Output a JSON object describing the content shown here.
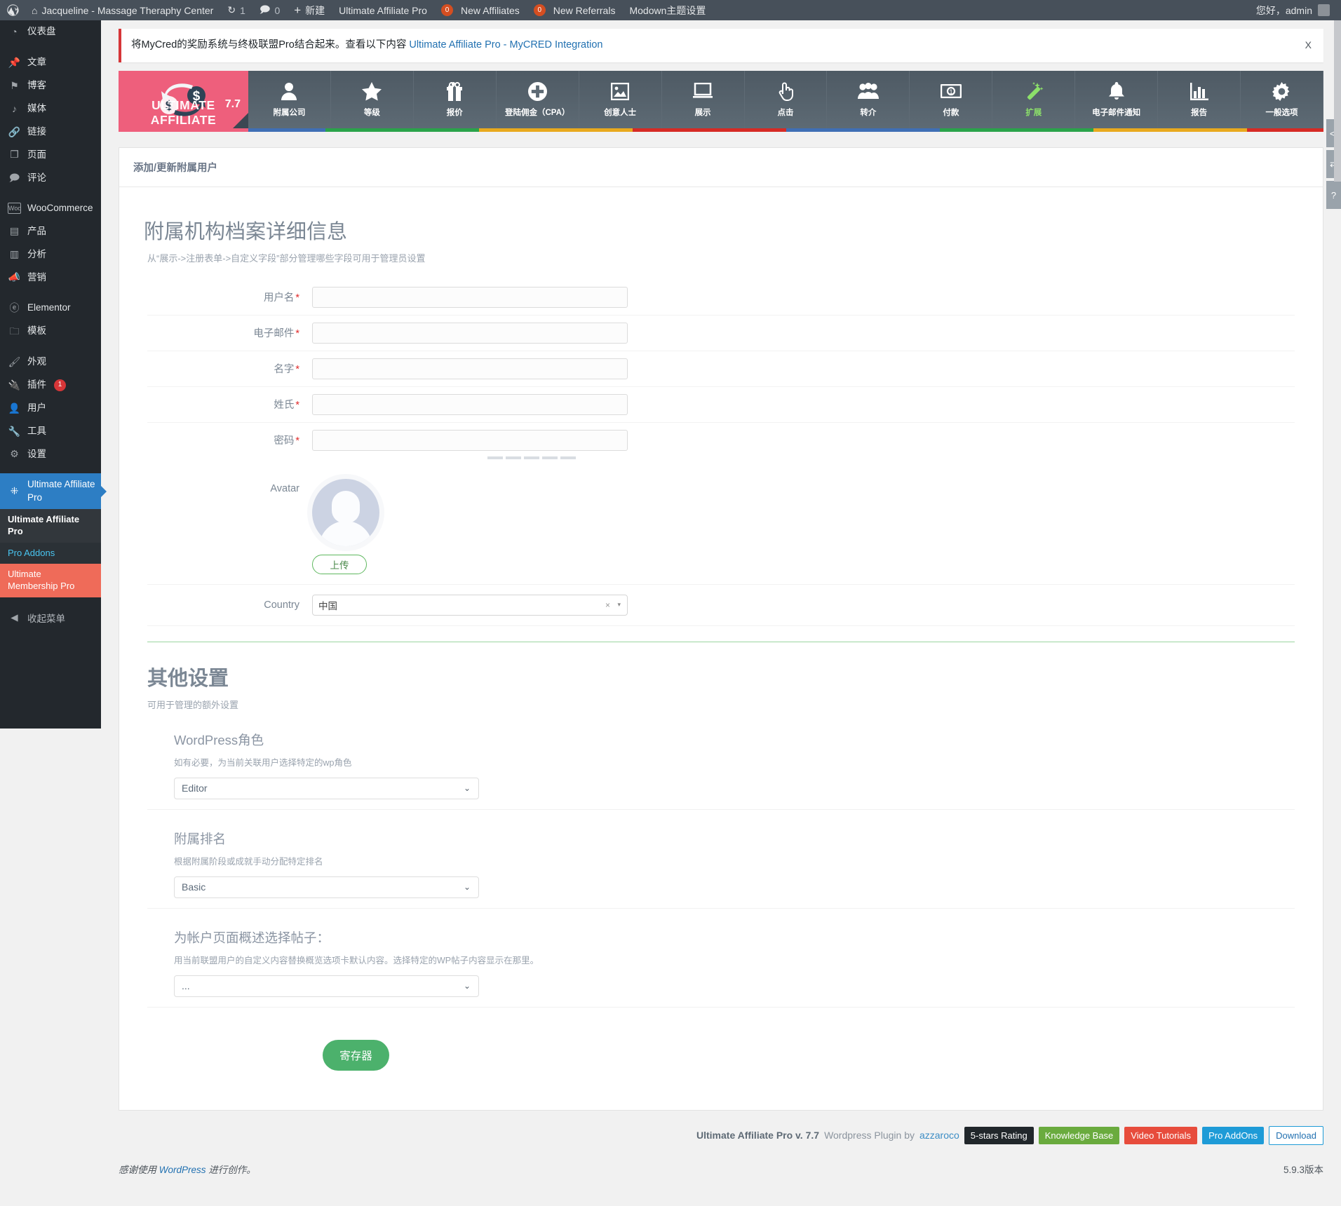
{
  "adminbar": {
    "logo_icon": "wordpress-icon",
    "home_icon": "home-icon",
    "site_name": "Jacqueline - Massage Theraphy Center",
    "updates_icon": "updates-icon",
    "updates_count": "1",
    "comments_icon": "comment-icon",
    "comments_count": "0",
    "new_icon": "plus-icon",
    "new_label": "新建",
    "uap_label": "Ultimate Affiliate Pro",
    "new_affiliates_badge": "0",
    "new_affiliates_label": "New Affiliates",
    "new_referrals_badge": "0",
    "new_referrals_label": "New Referrals",
    "modown_label": "Modown主题设置",
    "howdy": "您好，admin"
  },
  "sidebar": {
    "items": [
      {
        "icon": "dashboard-icon",
        "label": "仪表盘",
        "glyph": "◷"
      },
      {
        "icon": "pin-icon",
        "label": "文章",
        "glyph": "✎"
      },
      {
        "icon": "flag-icon",
        "label": "博客",
        "glyph": "⚑"
      },
      {
        "icon": "media-icon",
        "label": "媒体",
        "glyph": "♬"
      },
      {
        "icon": "link-icon",
        "label": "链接",
        "glyph": "🔗"
      },
      {
        "icon": "page-icon",
        "label": "页面",
        "glyph": "❐"
      },
      {
        "icon": "comment-icon",
        "label": "评论",
        "glyph": "💬"
      },
      {
        "icon": "woocommerce-icon",
        "label": "WooCommerce",
        "glyph": "W"
      },
      {
        "icon": "product-icon",
        "label": "产品",
        "glyph": "▤"
      },
      {
        "icon": "analytics-icon",
        "label": "分析",
        "glyph": "▥"
      },
      {
        "icon": "marketing-icon",
        "label": "营销",
        "glyph": "📢"
      },
      {
        "icon": "elementor-icon",
        "label": "Elementor",
        "glyph": "Ⓔ"
      },
      {
        "icon": "template-icon",
        "label": "模板",
        "glyph": "🗀"
      },
      {
        "icon": "appearance-icon",
        "label": "外观",
        "glyph": "🖌"
      },
      {
        "icon": "plugins-icon",
        "label": "插件",
        "glyph": "🔌",
        "badge": "1"
      },
      {
        "icon": "users-icon",
        "label": "用户",
        "glyph": "👤"
      },
      {
        "icon": "tools-icon",
        "label": "工具",
        "glyph": "🔧"
      },
      {
        "icon": "settings-icon",
        "label": "设置",
        "glyph": "⚙"
      }
    ],
    "current": {
      "icon": "sitemap-icon",
      "label": "Ultimate Affiliate Pro",
      "glyph": "⛓"
    },
    "submenu": [
      {
        "label": "Ultimate Affiliate Pro",
        "state": "head"
      },
      {
        "label": "Pro Addons",
        "state": "active"
      },
      {
        "label": "Ultimate Membership Pro",
        "state": "ump"
      }
    ],
    "collapse": {
      "icon": "collapse-icon",
      "label": "收起菜单"
    }
  },
  "notice": {
    "text": "将MyCred的奖励系统与终极联盟Pro结合起来。查看以下内容",
    "link": "Ultimate Affiliate Pro - MyCRED Integration",
    "close": "X"
  },
  "uap_nav": {
    "logo": {
      "version": "7.7",
      "wordmark": "ULTIMATE AFFILIATE"
    },
    "items": [
      {
        "icon": "user-icon",
        "label": "附属公司"
      },
      {
        "icon": "star-icon",
        "label": "等级"
      },
      {
        "icon": "gift-icon",
        "label": "报价"
      },
      {
        "icon": "plus-circle-icon",
        "label": "登陆佣金（CPA）"
      },
      {
        "icon": "image-icon",
        "label": "创意人士"
      },
      {
        "icon": "monitor-icon",
        "label": "展示"
      },
      {
        "icon": "click-hand-icon",
        "label": "点击"
      },
      {
        "icon": "group-icon",
        "label": "转介"
      },
      {
        "icon": "banknote-icon",
        "label": "付款"
      },
      {
        "icon": "magic-wand-icon",
        "label": "扩展",
        "accent": true
      },
      {
        "icon": "bell-icon",
        "label": "电子邮件通知"
      },
      {
        "icon": "bar-chart-icon",
        "label": "报告"
      },
      {
        "icon": "gear-icon",
        "label": "一般选项"
      }
    ],
    "stripe_colors": [
      "#3f6fb5",
      "#2aa34a",
      "#3f6fb5",
      "#2aa34a",
      "#e8a91d",
      "#e8a91d",
      "#d62b25",
      "#3f6fb5",
      "#3f6fb5",
      "#2aa34a",
      "#e8a91d",
      "#e8a91d",
      "#d62b25"
    ]
  },
  "page": {
    "card_title": "添加/更新附属用户",
    "section_title": "附属机构档案详细信息",
    "section_sub": "从“展示->注册表单->自定义字段”部分管理哪些字段可用于管理员设置",
    "fields": [
      {
        "label": "用户名",
        "required": true,
        "value": "",
        "name": "username"
      },
      {
        "label": "电子邮件",
        "required": true,
        "value": "",
        "name": "email"
      },
      {
        "label": "名字",
        "required": true,
        "value": "",
        "name": "first-name"
      },
      {
        "label": "姓氏",
        "required": true,
        "value": "",
        "name": "last-name"
      },
      {
        "label": "密码",
        "required": true,
        "value": "",
        "name": "password"
      }
    ],
    "avatar_label": "Avatar",
    "upload_label": "上传",
    "country_label": "Country",
    "country_value": "中国",
    "country_clear": "×",
    "country_caret": "▾"
  },
  "other": {
    "title": "其他设置",
    "sub": "可用于管理的额外设置",
    "blocks": [
      {
        "heading": "WordPress角色",
        "desc": "如有必要，为当前关联用户选择特定的wp角色",
        "value": "Editor",
        "name": "wp-role"
      },
      {
        "heading": "附属排名",
        "desc": "根据附属阶段或成就手动分配特定排名",
        "value": "Basic",
        "name": "affiliate-rank"
      },
      {
        "heading": "为帐户页面概述选择帖子：",
        "desc": "用当前联盟用户的自定义内容替换概览选项卡默认内容。选择特定的WP帖子内容显示在那里。",
        "value": "...",
        "name": "account-page-post"
      }
    ],
    "submit_label": "寄存器"
  },
  "footer": {
    "plugin_name": "Ultimate Affiliate Pro v. 7.7",
    "by_text": "Wordpress Plugin by",
    "author": "azzaroco",
    "buttons": [
      {
        "label": "5-stars Rating",
        "style": "dark"
      },
      {
        "label": "Knowledge Base",
        "style": "green"
      },
      {
        "label": "Video Tutorials",
        "style": "red"
      },
      {
        "label": "Pro AddOns",
        "style": "blue"
      },
      {
        "label": "Download",
        "style": "white"
      }
    ],
    "wp_thanks_pre": "感谢使用",
    "wp_link": "WordPress",
    "wp_thanks_post": "进行创作。",
    "version": "5.9.3版本"
  },
  "edge_panel": {
    "items": [
      {
        "icon": "code-icon",
        "glyph": "</"
      },
      {
        "icon": "arrows-icon",
        "glyph": "⇄"
      },
      {
        "icon": "help-icon",
        "glyph": "?"
      }
    ]
  }
}
